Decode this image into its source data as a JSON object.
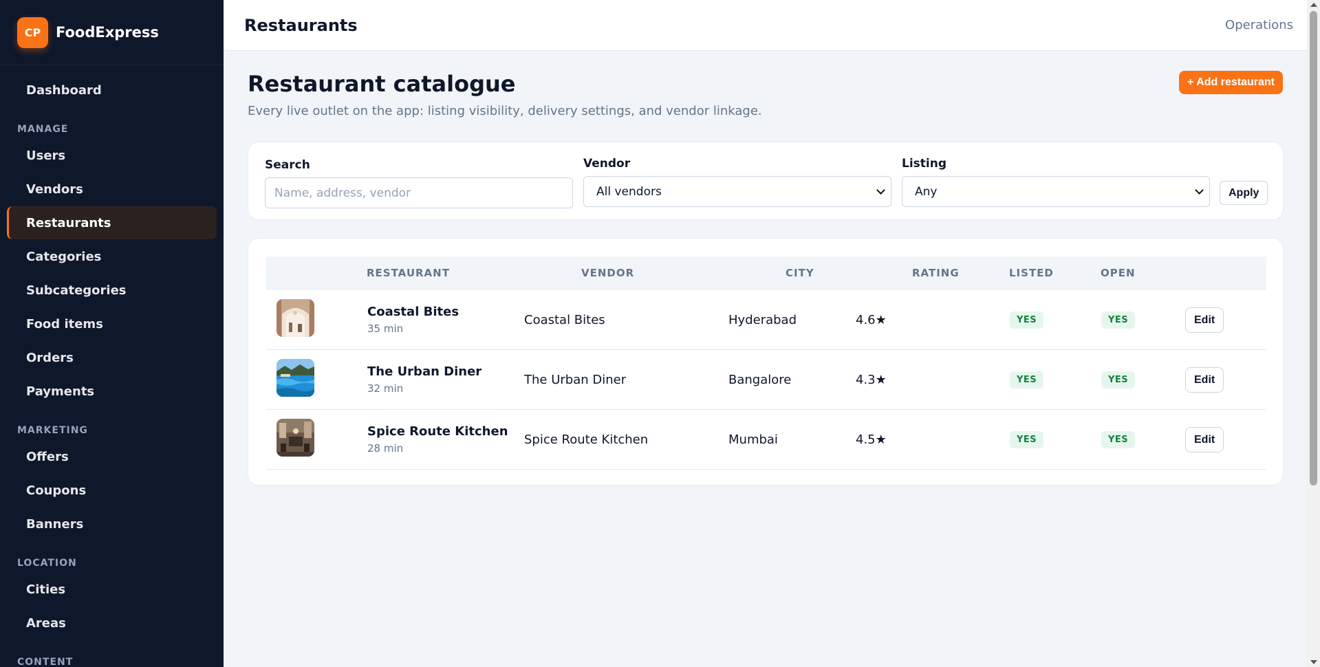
{
  "brand": {
    "logo": "CP",
    "name": "FoodExpress",
    "accent": "#f97316"
  },
  "sidebar": {
    "dashboard": "Dashboard",
    "sections": {
      "manage": "MANAGE",
      "marketing": "MARKETING",
      "location": "LOCATION",
      "content": "CONTENT"
    },
    "manage_items": [
      "Users",
      "Vendors",
      "Restaurants",
      "Categories",
      "Subcategories",
      "Food items",
      "Orders",
      "Payments"
    ],
    "marketing_items": [
      "Offers",
      "Coupons",
      "Banners"
    ],
    "location_items": [
      "Cities",
      "Areas"
    ],
    "active": "Restaurants"
  },
  "topbar": {
    "title": "Restaurants",
    "right": "Operations"
  },
  "page": {
    "title": "Restaurant catalogue",
    "subtitle": "Every live outlet on the app: listing visibility, delivery settings, and vendor linkage.",
    "add_button": "+ Add restaurant"
  },
  "filters": {
    "search_label": "Search",
    "search_placeholder": "Name, address, vendor",
    "vendor_label": "Vendor",
    "vendor_value": "All vendors",
    "listing_label": "Listing",
    "listing_value": "Any",
    "apply": "Apply"
  },
  "table": {
    "headers": [
      "RESTAURANT",
      "VENDOR",
      "CITY",
      "RATING",
      "LISTED",
      "OPEN"
    ],
    "rows": [
      {
        "name": "Coastal Bites",
        "time": "35 min",
        "vendor": "Coastal Bites",
        "city": "Hyderabad",
        "rating": "4.6★",
        "listed": "YES",
        "open": "YES",
        "edit": "Edit"
      },
      {
        "name": "The Urban Diner",
        "time": "32 min",
        "vendor": "The Urban Diner",
        "city": "Bangalore",
        "rating": "4.3★",
        "listed": "YES",
        "open": "YES",
        "edit": "Edit"
      },
      {
        "name": "Spice Route Kitchen",
        "time": "28 min",
        "vendor": "Spice Route Kitchen",
        "city": "Mumbai",
        "rating": "4.5★",
        "listed": "YES",
        "open": "YES",
        "edit": "Edit"
      }
    ]
  }
}
